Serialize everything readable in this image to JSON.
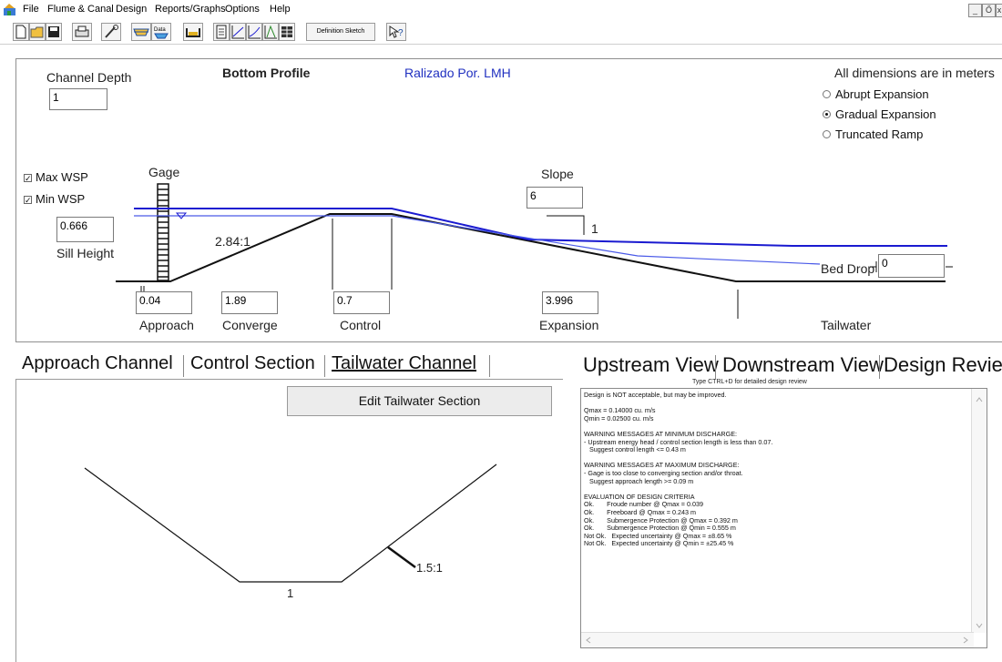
{
  "menu": {
    "items": [
      "File",
      "Flume & Canal",
      "Design",
      "Reports/Graphs",
      "Options",
      "Help"
    ]
  },
  "window_controls": {
    "minimize": "_",
    "restore": "Ő",
    "close": "x"
  },
  "toolbar": {
    "buttons": [
      "new-icon",
      "open-icon",
      "save-icon",
      "print-icon",
      "wrench-icon",
      "flume-icon",
      "data-icon",
      "channel-icon",
      "report-icon",
      "graph1-icon",
      "graph2-icon",
      "rating-icon",
      "table-icon",
      "help-icon"
    ],
    "data_button_label": "Data",
    "definition_sketch_label": "Definition Sketch"
  },
  "profile": {
    "channel_depth_label": "Channel Depth",
    "channel_depth_value": "1",
    "bottom_profile_title": "Bottom Profile",
    "author_label": "Ralizado Por. LMH",
    "units_note": "All dimensions are in meters",
    "expansion_options": [
      {
        "label": "Abrupt Expansion",
        "selected": false
      },
      {
        "label": "Gradual Expansion",
        "selected": true
      },
      {
        "label": "Truncated Ramp",
        "selected": false
      }
    ],
    "max_wsp_label": "Max WSP",
    "min_wsp_label": "Min WSP",
    "max_wsp_checked": true,
    "min_wsp_checked": true,
    "gage_label": "Gage",
    "sill_height_value": "0.666",
    "sill_height_label": "Sill Height",
    "converge_ratio": "2.84:1",
    "slope_label": "Slope",
    "slope_value": "6",
    "slope_rise": "1",
    "bed_drop_label": "Bed Drop",
    "bed_drop_value": "0",
    "approach_value": "0.04",
    "approach_label": "Approach",
    "converge_value": "1.89",
    "converge_label": "Converge",
    "control_value": "0.7",
    "control_label": "Control",
    "expansion_value": "3.996",
    "expansion_label": "Expansion",
    "tailwater_label": "Tailwater",
    "colors": {
      "max_wsp": "#1a1ad0",
      "min_wsp": "#4a5ae8",
      "bed": "#111111"
    }
  },
  "left_tabs": [
    "Approach Channel",
    "Control Section",
    "Tailwater Channel"
  ],
  "left_panel": {
    "edit_button_label": "Edit Tailwater Section",
    "bottom_width_label": "1",
    "side_slope_label": "1.5:1"
  },
  "right_tabs": [
    "Upstream View",
    "Downstream View",
    "Design Revie"
  ],
  "review": {
    "hint": "Type CTRL+D for detailed design review",
    "text": "Design is NOT acceptable, but may be improved.\n\nQmax = 0.14000 cu. m/s\nQmin = 0.02500 cu. m/s\n\nWARNING MESSAGES AT MINIMUM DISCHARGE:\n- Upstream energy head / control section length is less than 0.07.\n   Suggest control length <= 0.43 m\n\nWARNING MESSAGES AT MAXIMUM DISCHARGE:\n- Gage is too close to converging section and/or throat.\n   Suggest approach length >= 0.09 m\n\nEVALUATION OF DESIGN CRITERIA\nOk.       Froude number @ Qmax = 0.039\nOk.       Freeboard @ Qmax = 0.243 m\nOk.       Submergence Protection @ Qmax = 0.392 m\nOk.       Submergence Protection @ Qmin = 0.555 m\nNot Ok.   Expected uncertainty @ Qmax = ±8.65 %\nNot Ok.   Expected uncertainty @ Qmin = ±25.45 %"
  }
}
